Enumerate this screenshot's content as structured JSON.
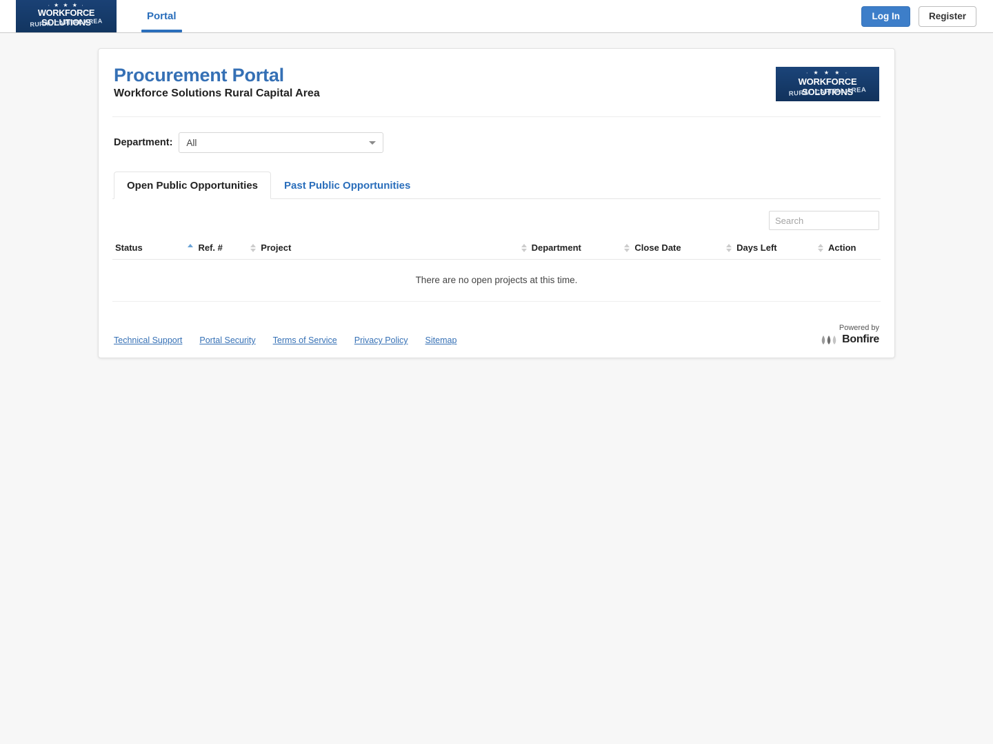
{
  "navbar": {
    "logo": {
      "stars": "∙ ★ ★ ★ ∙",
      "line1": "WORKFORCE SOLUTIONS",
      "line2": "RURAL CAPITAL AREA",
      "color": "#153a6b"
    },
    "items": [
      {
        "label": "Portal",
        "active": true
      }
    ],
    "login_label": "Log In",
    "register_label": "Register",
    "login_color": "#3d7ec9"
  },
  "header": {
    "title": "Procurement Portal",
    "subtitle": "Workforce Solutions Rural Capital Area",
    "title_color": "#3570b5",
    "logo": {
      "stars": "∙ ★ ★ ★ ∙",
      "line1": "WORKFORCE SOLUTIONS",
      "line2": "RURAL CAPITAL AREA"
    }
  },
  "filter": {
    "label": "Department:",
    "selected": "All",
    "options": [
      "All"
    ]
  },
  "tabs": [
    {
      "label": "Open Public Opportunities",
      "active": true
    },
    {
      "label": "Past Public Opportunities",
      "active": false
    }
  ],
  "search": {
    "placeholder": "Search",
    "value": ""
  },
  "table": {
    "columns": [
      {
        "label": "Status",
        "sort": "asc"
      },
      {
        "label": "Ref. #",
        "sort": "none"
      },
      {
        "label": "Project",
        "sort": "none"
      },
      {
        "label": "Department",
        "sort": "none"
      },
      {
        "label": "Close Date",
        "sort": "none"
      },
      {
        "label": "Days Left",
        "sort": "none"
      },
      {
        "label": "Action",
        "sort": "none"
      }
    ],
    "rows": [],
    "empty_message": "There are no open projects at this time."
  },
  "footer": {
    "links": [
      {
        "label": "Technical Support"
      },
      {
        "label": "Portal Security"
      },
      {
        "label": "Terms of Service"
      },
      {
        "label": "Privacy Policy"
      },
      {
        "label": "Sitemap"
      }
    ],
    "powered_by_label": "Powered by",
    "powered_by_name": "Bonfire"
  }
}
